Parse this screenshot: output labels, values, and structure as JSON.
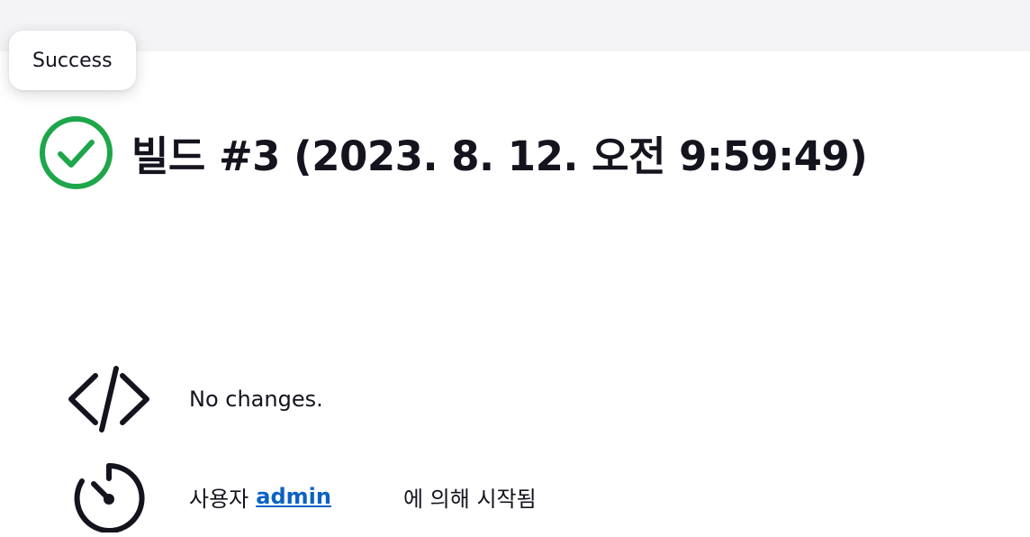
{
  "tooltip": {
    "label": "Success"
  },
  "build": {
    "title": "빌드 #3 (2023. 8. 12. 오전 9:59:49)",
    "status_icon": "check-circle-icon",
    "status_color": "#1ea64a"
  },
  "changes": {
    "icon": "code-icon",
    "text": "No changes."
  },
  "cause": {
    "icon": "timer-icon",
    "prefix": "사용자",
    "user": "admin",
    "suffix": "에 의해 시작됨",
    "link_color": "#0b62c4"
  }
}
